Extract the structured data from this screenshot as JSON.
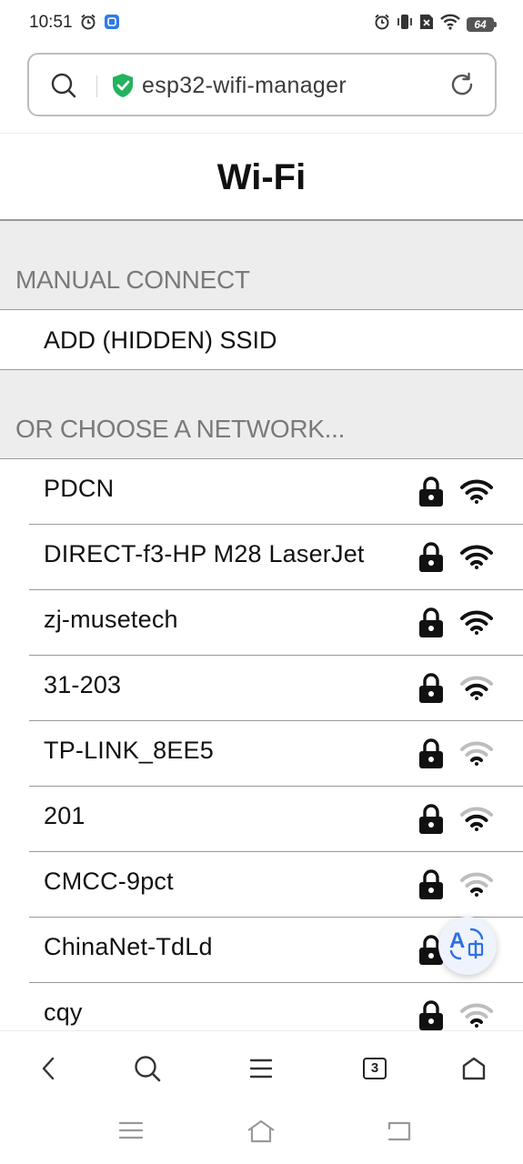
{
  "status_bar": {
    "time": "10:51",
    "left_icons": [
      "alarm-icon",
      "app-notification-icon"
    ],
    "right_icons": [
      "alarm-icon",
      "vibrate-icon",
      "no-sim-icon",
      "wifi-icon"
    ],
    "battery": "64"
  },
  "browser": {
    "url_text": "esp32-wifi-manager"
  },
  "page": {
    "title": "Wi-Fi",
    "manual_header": "MANUAL CONNECT",
    "manual_item": "ADD (HIDDEN) SSID",
    "choose_header": "OR CHOOSE A NETWORK...",
    "networks": [
      {
        "ssid": "PDCN",
        "secured": true,
        "signal": "strong"
      },
      {
        "ssid": "DIRECT-f3-HP M28 LaserJet",
        "secured": true,
        "signal": "strong"
      },
      {
        "ssid": "zj-musetech",
        "secured": true,
        "signal": "strong"
      },
      {
        "ssid": "31-203",
        "secured": true,
        "signal": "medium"
      },
      {
        "ssid": "TP-LINK_8EE5",
        "secured": true,
        "signal": "weak"
      },
      {
        "ssid": "201",
        "secured": true,
        "signal": "medium"
      },
      {
        "ssid": "CMCC-9pct",
        "secured": true,
        "signal": "weak"
      },
      {
        "ssid": "ChinaNet-TdLd",
        "secured": true,
        "signal": "weak"
      },
      {
        "ssid": "cqy",
        "secured": true,
        "signal": "weak"
      }
    ]
  },
  "bottom_bar": {
    "tab_count": "3"
  },
  "colors": {
    "shield_green": "#22b35e",
    "translate_blue": "#2f6fe4",
    "section_bg": "#ededed",
    "section_text": "#7a7a7a"
  }
}
